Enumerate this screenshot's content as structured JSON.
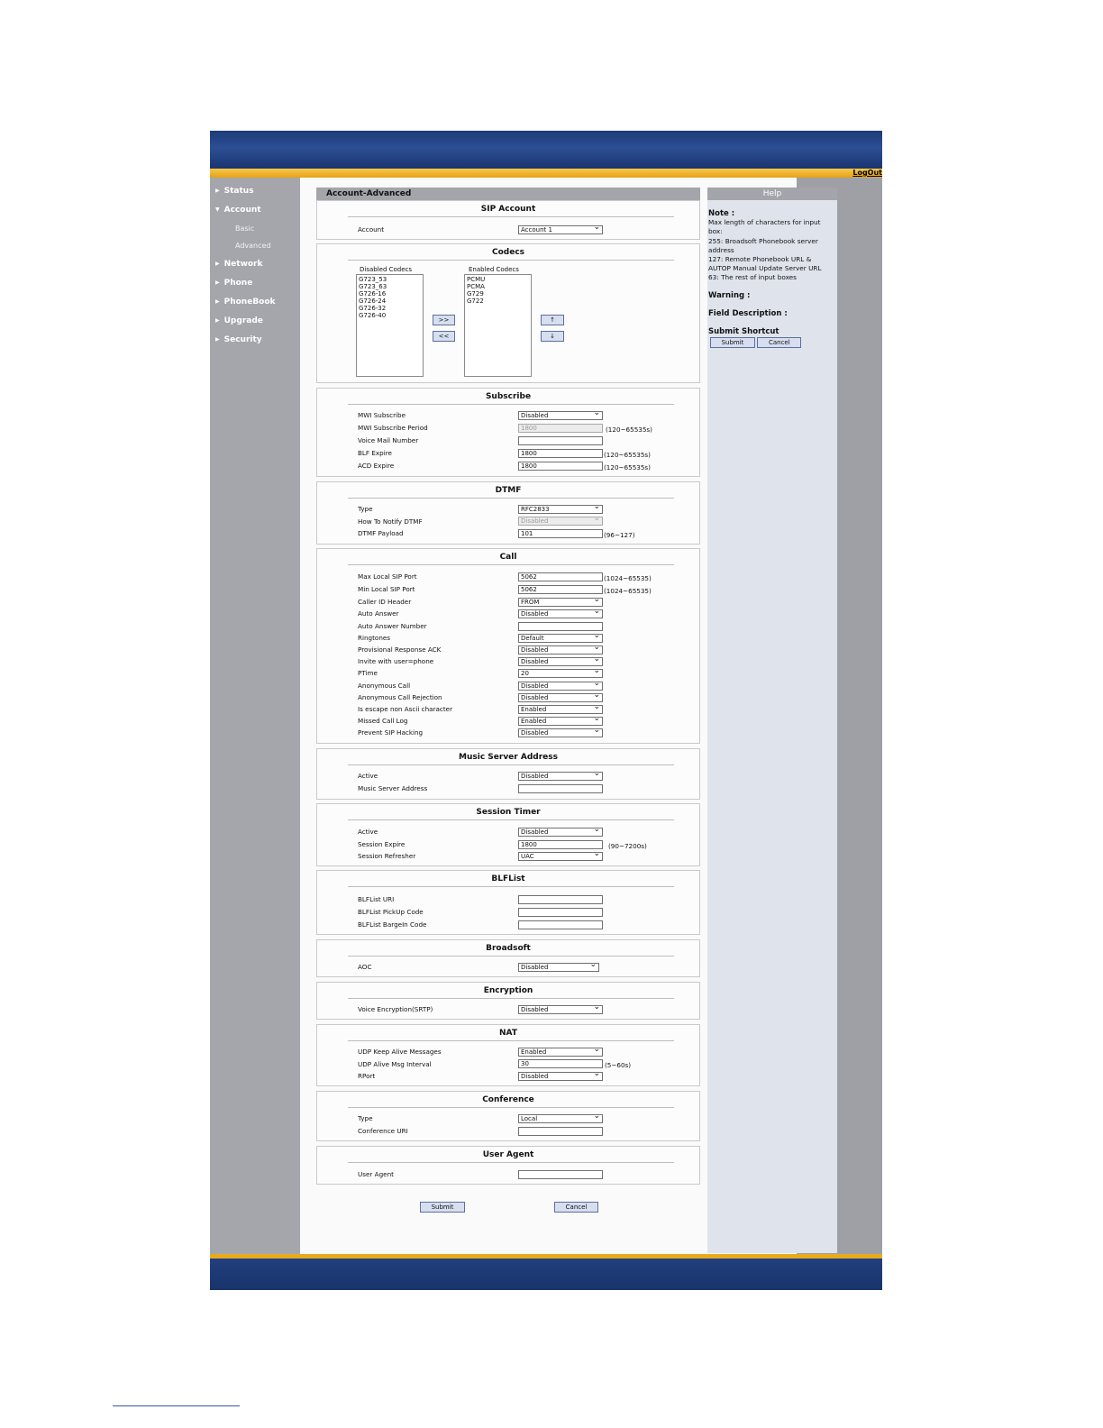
{
  "header": {
    "logout": "LogOut"
  },
  "nav": {
    "status": "Status",
    "account": "Account",
    "basic": "Basic",
    "advanced": "Advanced",
    "network": "Network",
    "phone": "Phone",
    "phonebook": "PhoneBook",
    "upgrade": "Upgrade",
    "security": "Security"
  },
  "page_title": "Account-Advanced",
  "help": {
    "title": "Help",
    "note_label": "Note :",
    "note_lines": [
      "Max length of characters for input",
      "box:",
      "255: Broadsoft Phonebook server",
      "address",
      "127: Remote Phonebook URL &",
      "AUTOP Manual Update Server URL",
      "63: The rest of input boxes"
    ],
    "warning_label": "Warning :",
    "field_desc_label": "Field Description :",
    "shortcut_label": "Submit Shortcut",
    "submit": "Submit",
    "cancel": "Cancel"
  },
  "sip_account": {
    "title": "SIP Account",
    "account_label": "Account",
    "account_value": "Account 1"
  },
  "codecs": {
    "title": "Codecs",
    "disabled_label": "Disabled Codecs",
    "enabled_label": "Enabled Codecs",
    "disabled": [
      "G723_53",
      "G723_63",
      "G726-16",
      "G726-24",
      "G726-32",
      "G726-40"
    ],
    "enabled": [
      "PCMU",
      "PCMA",
      "G729",
      "G722"
    ],
    "add": ">>",
    "remove": "<<",
    "up": "↑",
    "down": "↓"
  },
  "subscribe": {
    "title": "Subscribe",
    "mwi_label": "MWI Subscribe",
    "mwi_value": "Disabled",
    "mwi_period_label": "MWI Subscribe Period",
    "mwi_period_value": "1800",
    "mwi_period_range": "(120~65535s)",
    "voicemail_label": "Voice Mail Number",
    "voicemail_value": "",
    "blf_label": "BLF Expire",
    "blf_value": "1800",
    "blf_range": "(120~65535s)",
    "acd_label": "ACD Expire",
    "acd_value": "1800",
    "acd_range": "(120~65535s)"
  },
  "dtmf": {
    "title": "DTMF",
    "type_label": "Type",
    "type_value": "RFC2833",
    "notify_label": "How To Notify DTMF",
    "notify_value": "Disabled",
    "payload_label": "DTMF Payload",
    "payload_value": "101",
    "payload_range": "(96~127)"
  },
  "call": {
    "title": "Call",
    "max_port_label": "Max Local SIP Port",
    "max_port_value": "5062",
    "max_port_range": "(1024~65535)",
    "min_port_label": "Min Local SIP Port",
    "min_port_value": "5062",
    "min_port_range": "(1024~65535)",
    "caller_id_label": "Caller ID Header",
    "caller_id_value": "FROM",
    "auto_answer_label": "Auto Answer",
    "auto_answer_value": "Disabled",
    "auto_answer_num_label": "Auto Answer Number",
    "auto_answer_num_value": "",
    "ringtones_label": "Ringtones",
    "ringtones_value": "Default",
    "prov_ack_label": "Provisional Response ACK",
    "prov_ack_value": "Disabled",
    "invite_label": "Invite with user=phone",
    "invite_value": "Disabled",
    "ptime_label": "PTime",
    "ptime_value": "20",
    "anon_label": "Anonymous Call",
    "anon_value": "Disabled",
    "anon_rej_label": "Anonymous Call Rejection",
    "anon_rej_value": "Disabled",
    "escape_label": "Is escape non Ascii character",
    "escape_value": "Enabled",
    "missed_label": "Missed Call Log",
    "missed_value": "Enabled",
    "hacking_label": "Prevent SIP Hacking",
    "hacking_value": "Disabled"
  },
  "music": {
    "title": "Music Server Address",
    "active_label": "Active",
    "active_value": "Disabled",
    "address_label": "Music Server Address",
    "address_value": ""
  },
  "session_timer": {
    "title": "Session Timer",
    "active_label": "Active",
    "active_value": "Disabled",
    "expire_label": "Session Expire",
    "expire_value": "1800",
    "expire_range": "(90~7200s)",
    "refresher_label": "Session Refresher",
    "refresher_value": "UAC"
  },
  "blflist": {
    "title": "BLFList",
    "uri_label": "BLFList URI",
    "pickup_label": "BLFList PickUp Code",
    "bargein_label": "BLFList BargeIn Code"
  },
  "broadsoft": {
    "title": "Broadsoft",
    "aoc_label": "AOC",
    "aoc_value": "Disabled"
  },
  "encryption": {
    "title": "Encryption",
    "srtp_label": "Voice Encryption(SRTP)",
    "srtp_value": "Disabled"
  },
  "nat": {
    "title": "NAT",
    "keepalive_label": "UDP Keep Alive Messages",
    "keepalive_value": "Enabled",
    "interval_label": "UDP Alive Msg Interval",
    "interval_value": "30",
    "interval_range": "(5~60s)",
    "rport_label": "RPort",
    "rport_value": "Disabled"
  },
  "conference": {
    "title": "Conference",
    "type_label": "Type",
    "type_value": "Local",
    "uri_label": "Conference URI",
    "uri_value": ""
  },
  "user_agent": {
    "title": "User Agent",
    "label": "User Agent",
    "value": ""
  },
  "actions": {
    "submit": "Submit",
    "cancel": "Cancel"
  }
}
